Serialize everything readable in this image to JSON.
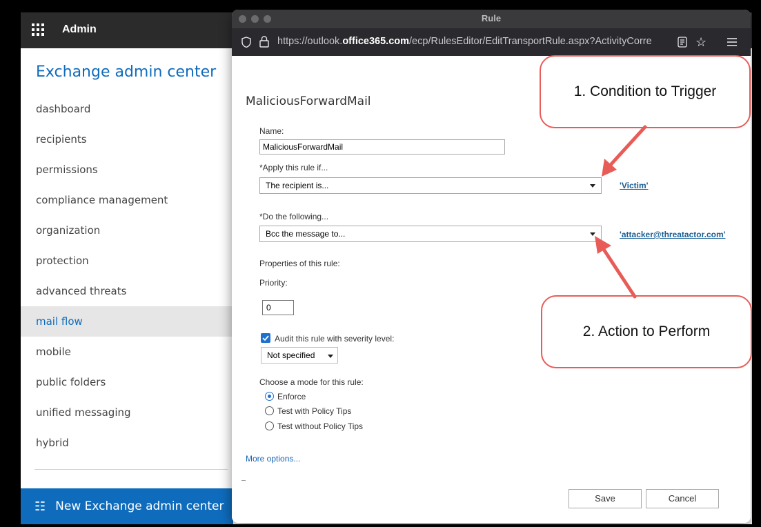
{
  "admin": {
    "top_label": "Admin",
    "title": "Exchange admin center",
    "nav": [
      {
        "label": "dashboard",
        "active": false
      },
      {
        "label": "recipients",
        "active": false
      },
      {
        "label": "permissions",
        "active": false
      },
      {
        "label": "compliance management",
        "active": false
      },
      {
        "label": "organization",
        "active": false
      },
      {
        "label": "protection",
        "active": false
      },
      {
        "label": "advanced threats",
        "active": false
      },
      {
        "label": "mail flow",
        "active": true
      },
      {
        "label": "mobile",
        "active": false
      },
      {
        "label": "public folders",
        "active": false
      },
      {
        "label": "unified messaging",
        "active": false
      },
      {
        "label": "hybrid",
        "active": false
      }
    ],
    "new_center_label": "New Exchange admin center",
    "new_center_icon": "exchange-icon",
    "accent_color": "#0f6cbd"
  },
  "browser": {
    "window_title": "Rule",
    "url_prefix": "https://outlook.",
    "url_domain": "office365.com",
    "url_suffix": "/ecp/RulesEditor/EditTransportRule.aspx?ActivityCorre"
  },
  "rule": {
    "title": "MaliciousForwardMail",
    "name_label": "Name:",
    "name_value": "MaliciousForwardMail",
    "condition_label": "*Apply this rule if...",
    "condition_value": "The recipient is...",
    "condition_target": "'Victim'",
    "action_label": "*Do the following...",
    "action_value": "Bcc the message to...",
    "action_target": "'attacker@threatactor.com'",
    "properties_label": "Properties of this rule:",
    "priority_label": "Priority:",
    "priority_value": "0",
    "audit_label": "Audit this rule with severity level:",
    "audit_checked": true,
    "severity_value": "Not specified",
    "mode_label": "Choose a mode for this rule:",
    "modes": [
      {
        "label": "Enforce",
        "checked": true
      },
      {
        "label": "Test with Policy Tips",
        "checked": false
      },
      {
        "label": "Test without Policy Tips",
        "checked": false
      }
    ],
    "more_options": "More options...",
    "save_label": "Save",
    "cancel_label": "Cancel"
  },
  "annotations": {
    "callout_1": "1. Condition to Trigger",
    "callout_2": "2. Action to Perform",
    "color": "#e85c58"
  }
}
